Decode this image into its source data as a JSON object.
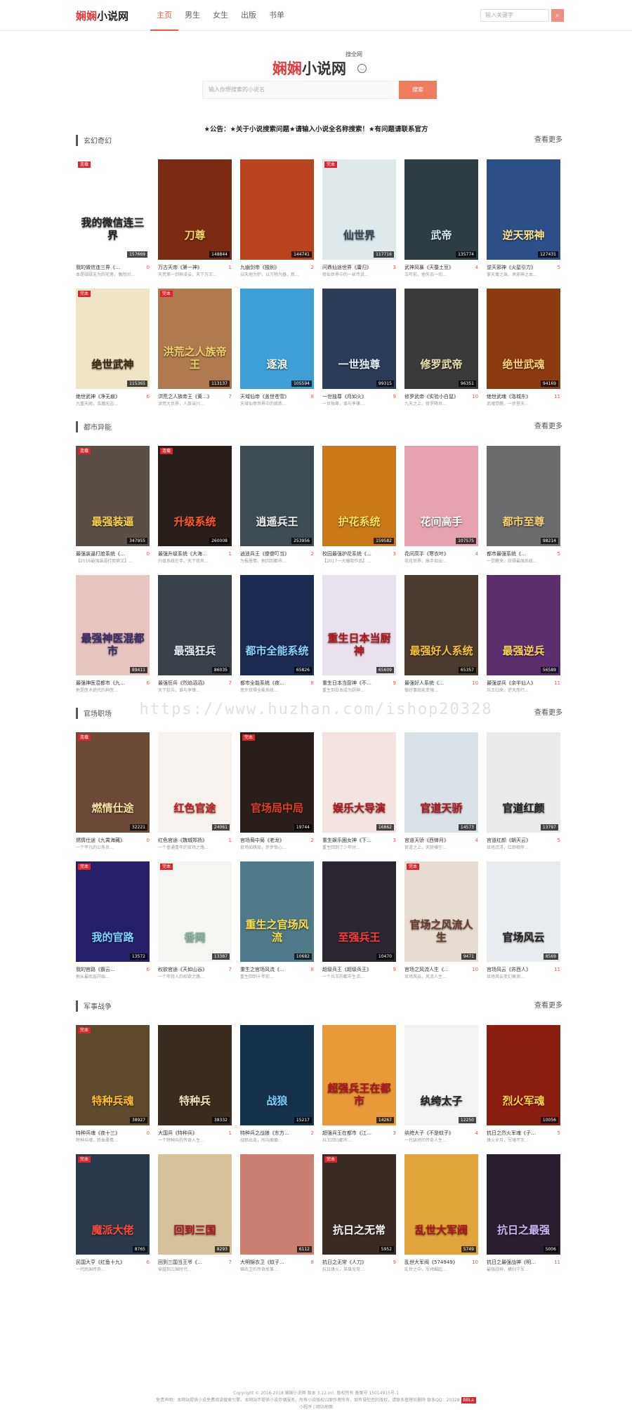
{
  "site": {
    "logo_hl": "娴娴",
    "logo_rest": "小说网",
    "nav": [
      "主页",
      "男生",
      "女生",
      "出版",
      "书单"
    ],
    "active_nav": 0,
    "top_search_placeholder": "输入关键字",
    "top_search_icon": "search-icon"
  },
  "hero": {
    "logo_hl": "娴娴",
    "logo_rest": "小说网",
    "tagline": "搜全网",
    "search_placeholder": "输入你想搜索的小说名",
    "search_button": "搜索"
  },
  "notice": "★公告：★关于小说搜索问题★请输入小说全名称搜索！★有问题请联系官方",
  "watermark": "https://www.huzhan.com/ishop20328",
  "colors": {
    "accent": "#ef5a3c",
    "tag": "#d9262c"
  },
  "sections": [
    {
      "title": "玄幻奇幻",
      "more": "查看更多",
      "books": [
        {
          "tag": "连载",
          "cnt": "157669",
          "name": "我的微信连三界《…",
          "num": "0",
          "desc": "本是碌碌无为的宅男，偶然间…",
          "ctitle": "我的微信连三界",
          "bg": "#ffffff",
          "fg": "#222222"
        },
        {
          "tag": "",
          "cnt": "148844",
          "name": "万古天帝《第一神》",
          "num": "1",
          "desc": "天荒第一剑神凌云，天下万王…",
          "ctitle": "刀尊",
          "bg": "#7a2b12",
          "fg": "#f7d56a"
        },
        {
          "tag": "",
          "cnt": "144741",
          "name": "九幽剑帝《独别》",
          "num": "2",
          "desc": "以天地为炉，以万物为器，炼…",
          "ctitle": "",
          "bg": "#b8431c",
          "fg": "#ffe08a"
        },
        {
          "tag": "完本",
          "cnt": "117716",
          "name": "问鼎仙途世界《庸归》",
          "num": "3",
          "desc": "修仙世界中的一丝传说…",
          "ctitle": "仙世界",
          "bg": "#dfe8ea",
          "fg": "#34495a"
        },
        {
          "tag": "",
          "cnt": "135774",
          "name": "武神风暴《天蚕土豆》",
          "num": "4",
          "desc": "五年前，他失去一切…",
          "ctitle": "武帝",
          "bg": "#2e3d44",
          "fg": "#d6e8f0"
        },
        {
          "tag": "",
          "cnt": "127431",
          "name": "逆天邪神《火星引力》",
          "num": "5",
          "desc": "掌天毒之珠，承邪神之血…",
          "ctitle": "逆天邪神",
          "bg": "#2b4f86",
          "fg": "#ffe28a"
        },
        {
          "tag": "完本",
          "cnt": "115365",
          "name": "绝世武神《净无痕》",
          "num": "6",
          "desc": "九重天阙，浩瀚无边…",
          "ctitle": "绝世武神",
          "bg": "#efe4c6",
          "fg": "#3b2a14"
        },
        {
          "tag": "完本",
          "cnt": "113137",
          "name": "洪荒之人族帝王《黄…》",
          "num": "7",
          "desc": "洪荒大世界，人族当兴…",
          "ctitle": "洪荒之人族帝王",
          "bg": "#b07a4e",
          "fg": "#f2d36b"
        },
        {
          "tag": "",
          "cnt": "105594",
          "name": "天域仙帝《盖世苍雪》",
          "num": "8",
          "desc": "天域仙帝世界中的修炼…",
          "ctitle": "逐浪",
          "bg": "#3d9fd6",
          "fg": "#ffffff"
        },
        {
          "tag": "",
          "cnt": "99315",
          "name": "一世独尊《月如火》",
          "num": "9",
          "desc": "一世独尊，谁与争锋…",
          "ctitle": "一世独尊",
          "bg": "#2c3b56",
          "fg": "#e8eef6"
        },
        {
          "tag": "",
          "cnt": "96351",
          "name": "修罗武帝《实验小白鼠》",
          "num": "10",
          "desc": "九天之上，修罗降世…",
          "ctitle": "修罗武帝",
          "bg": "#3a3a3a",
          "fg": "#f0e2b0"
        },
        {
          "tag": "",
          "cnt": "94169",
          "name": "绝世武魂《洛城东》",
          "num": "11",
          "desc": "武魂觉醒，一步登天…",
          "ctitle": "绝世武魂",
          "bg": "#8c3b10",
          "fg": "#ffd37a"
        }
      ]
    },
    {
      "title": "都市异能",
      "more": "查看更多",
      "books": [
        {
          "tag": "连载",
          "cnt": "347955",
          "name": "最强装逼打脸系统《…",
          "num": "0",
          "desc": "【2016最强装逼打脸爽文】…",
          "ctitle": "最强装逼",
          "bg": "#5b4e46",
          "fg": "#ffcf4a"
        },
        {
          "tag": "连载",
          "cnt": "260008",
          "name": "最强升级系统《大海…",
          "num": "1",
          "desc": "升级系统在手，天下我有…",
          "ctitle": "升级系统",
          "bg": "#2a1e1a",
          "fg": "#ff5a2a"
        },
        {
          "tag": "",
          "cnt": "253956",
          "name": "逍遥兵王《傻傻叮当》",
          "num": "2",
          "desc": "为报恩情，他回到都市…",
          "ctitle": "逍遥兵王",
          "bg": "#3d4c52",
          "fg": "#f2f2f2"
        },
        {
          "tag": "",
          "cnt": "159582",
          "name": "校园最强护花系统《…",
          "num": "3",
          "desc": "【2017一大爆款作品】…",
          "ctitle": "护花系统",
          "bg": "#c9791a",
          "fg": "#ffe45a"
        },
        {
          "tag": "",
          "cnt": "107575",
          "name": "花间高手《寒衣叶》",
          "num": "4",
          "desc": "花花世界，高手如云…",
          "ctitle": "花间高手",
          "bg": "#e8a3b0",
          "fg": "#ffffff"
        },
        {
          "tag": "",
          "cnt": "98214",
          "name": "都市最强系统《…",
          "num": "5",
          "desc": "一觉醒来，获得最强系统…",
          "ctitle": "都市至尊",
          "bg": "#6a6b6c",
          "fg": "#f8d46e"
        },
        {
          "tag": "",
          "cnt": "89411",
          "name": "最强神医混都市《九…",
          "num": "6",
          "desc": "他是医术绝代的神医…",
          "ctitle": "最强神医混都市",
          "bg": "#e6c4c0",
          "fg": "#3a2a66"
        },
        {
          "tag": "",
          "cnt": "86035",
          "name": "最强狂兵《烈焰滔滔》",
          "num": "7",
          "desc": "天下狂兵，谁与争锋…",
          "ctitle": "最强狂兵",
          "bg": "#39414a",
          "fg": "#e8edf2"
        },
        {
          "tag": "",
          "cnt": "65826",
          "name": "都市全能系统《夜…",
          "num": "8",
          "desc": "意外获得全能系统…",
          "ctitle": "都市全能系统",
          "bg": "#1b2a52",
          "fg": "#8ad4ff"
        },
        {
          "tag": "",
          "cnt": "65609",
          "name": "重生日本当厨神《不…",
          "num": "9",
          "desc": "重生到日本成为厨神…",
          "ctitle": "重生日本当厨神",
          "bg": "#e9e1ee",
          "fg": "#b2141c"
        },
        {
          "tag": "",
          "cnt": "65357",
          "name": "最强好人系统《…",
          "num": "10",
          "desc": "做好事就能变强…",
          "ctitle": "最强好人系统",
          "bg": "#4a3b2e",
          "fg": "#f4c23a"
        },
        {
          "tag": "",
          "cnt": "56589",
          "name": "最强逆兵《余半仙人》",
          "num": "11",
          "desc": "兵王归来，逆天而行…",
          "ctitle": "最强逆兵",
          "bg": "#5c2e6e",
          "fg": "#ffd45a"
        }
      ]
    },
    {
      "title": "官场职场",
      "more": "查看更多",
      "books": [
        {
          "tag": "连载",
          "cnt": "32221",
          "name": "燃情仕途《九霄海藏》",
          "num": "0",
          "desc": "一个平凡的公务员…",
          "ctitle": "燃情仕途",
          "bg": "#6b4a38",
          "fg": "#f7e3a2"
        },
        {
          "tag": "",
          "cnt": "24061",
          "name": "红色官途《魏城郑扬》",
          "num": "1",
          "desc": "一个普通青年的官场之路…",
          "ctitle": "红色官途",
          "bg": "#f7f2ee",
          "fg": "#c81e1e"
        },
        {
          "tag": "完本",
          "cnt": "19744",
          "name": "官场局中局《老龙》",
          "num": "2",
          "desc": "官场如棋局，步步惊心…",
          "ctitle": "官场局中局",
          "bg": "#2a1e1a",
          "fg": "#e33b2f"
        },
        {
          "tag": "",
          "cnt": "16862",
          "name": "重生娱乐圈女神《下…",
          "num": "3",
          "desc": "重生回到了少年时…",
          "ctitle": "娱乐大导演",
          "bg": "#f3e4e1",
          "fg": "#b2141c"
        },
        {
          "tag": "",
          "cnt": "14573",
          "name": "官道天骄《西锋月》",
          "num": "4",
          "desc": "官道之上，天骄横空…",
          "ctitle": "官道天骄",
          "bg": "#d9e2e6",
          "fg": "#b2141c"
        },
        {
          "tag": "",
          "cnt": "13797",
          "name": "官道红颜《朝天云》",
          "num": "5",
          "desc": "官场沉浮，红颜相伴…",
          "ctitle": "官道红颜",
          "bg": "#eaeaea",
          "fg": "#222222"
        },
        {
          "tag": "完本",
          "cnt": "13572",
          "name": "我的官路《霸云…",
          "num": "6",
          "desc": "他从最底层开始…",
          "ctitle": "我的官路",
          "bg": "#26206a",
          "fg": "#7fd6ff"
        },
        {
          "tag": "完本",
          "cnt": "13387",
          "name": "权欲官途《天如山谷》",
          "num": "7",
          "desc": "一个年轻人的权欲之路…",
          "ctitle": "香网",
          "bg": "#f4f6f2",
          "fg": "#8ab8a2"
        },
        {
          "tag": "",
          "cnt": "10682",
          "name": "重生之官场风流《…",
          "num": "8",
          "desc": "重生回到十年前…",
          "ctitle": "重生之官场风流",
          "bg": "#4e7a8a",
          "fg": "#ffe04a"
        },
        {
          "tag": "",
          "cnt": "10470",
          "name": "超级兵王《超级兵王》",
          "num": "9",
          "desc": "一个兵王的都市生活…",
          "ctitle": "至强兵王",
          "bg": "#2b2630",
          "fg": "#ff3a3a"
        },
        {
          "tag": "完本",
          "cnt": "9471",
          "name": "官场之风流人生《…",
          "num": "10",
          "desc": "官场风云，风流人生…",
          "ctitle": "官场之风流人生",
          "bg": "#e7dcd2",
          "fg": "#6a3a2a"
        },
        {
          "tag": "",
          "cnt": "8569",
          "name": "官场风云《苏西人》",
          "num": "11",
          "desc": "官场风云变幻莫测…",
          "ctitle": "官场风云",
          "bg": "#e8ecef",
          "fg": "#222222"
        }
      ]
    },
    {
      "title": "军事战争",
      "more": "查看更多",
      "books": [
        {
          "tag": "完本",
          "cnt": "38927",
          "name": "特种兵魂《夜十三》",
          "num": "0",
          "desc": "特种兵魂，铁血柔情…",
          "ctitle": "特种兵魂",
          "bg": "#5d4a2e",
          "fg": "#ffc02a"
        },
        {
          "tag": "",
          "cnt": "38332",
          "name": "大国兵《特种兵》",
          "num": "1",
          "desc": "一个特种兵的传奇人生…",
          "ctitle": "特种兵",
          "bg": "#3b2c20",
          "fg": "#f2e2c0"
        },
        {
          "tag": "",
          "cnt": "15217",
          "name": "特种兵之战狼《东方…",
          "num": "2",
          "desc": "战狼出击，所向披靡…",
          "ctitle": "战狼",
          "bg": "#16324a",
          "fg": "#7ad2ff"
        },
        {
          "tag": "",
          "cnt": "14267",
          "name": "超强兵王在都市《江…",
          "num": "3",
          "desc": "兵王回归都市…",
          "ctitle": "超强兵王在都市",
          "bg": "#e89a3a",
          "fg": "#b2141c"
        },
        {
          "tag": "",
          "cnt": "12250",
          "name": "纨绔大子《不是蚊子》",
          "num": "4",
          "desc": "一代纨绔的传奇人生…",
          "ctitle": "纨绔太子",
          "bg": "#f3f3f3",
          "fg": "#222222"
        },
        {
          "tag": "",
          "cnt": "10056",
          "name": "抗日之烈火军魂《子…",
          "num": "5",
          "desc": "烽火岁月，军魂不灭…",
          "ctitle": "烈火军魂",
          "bg": "#8a1e10",
          "fg": "#ffd54a"
        },
        {
          "tag": "完本",
          "cnt": "8765",
          "name": "民国大亨《红鱼十九》",
          "num": "6",
          "desc": "一代民国传奇…",
          "ctitle": "魔派大佬",
          "bg": "#2a3a4a",
          "fg": "#ff4a3a"
        },
        {
          "tag": "",
          "cnt": "8293",
          "name": "回到三国当王爷《…",
          "num": "7",
          "desc": "穿越到三国时代…",
          "ctitle": "回到三国",
          "bg": "#d6c29a",
          "fg": "#b2141c"
        },
        {
          "tag": "",
          "cnt": "6112",
          "name": "大明锦衣卫《蚊子…",
          "num": "8",
          "desc": "锦衣卫的传奇故事…",
          "ctitle": "",
          "bg": "#c98070",
          "fg": "#ffffff"
        },
        {
          "tag": "完本",
          "cnt": "5952",
          "name": "抗日之无常《人刀》",
          "num": "9",
          "desc": "抗日烽火，英雄无常…",
          "ctitle": "抗日之无常",
          "bg": "#3a2b24",
          "fg": "#ffffff"
        },
        {
          "tag": "",
          "cnt": "5749",
          "name": "乱世大军阀《574949》",
          "num": "10",
          "desc": "乱世之中，军阀崛起…",
          "ctitle": "乱世大军阀",
          "bg": "#e0a43a",
          "fg": "#b2141c"
        },
        {
          "tag": "",
          "cnt": "5006",
          "name": "抗日之最强战神《明…",
          "num": "11",
          "desc": "最强战神，横扫千军…",
          "ctitle": "抗日之最强",
          "bg": "#2a1e2e",
          "fg": "#c9b6f2"
        }
      ]
    }
  ],
  "footer": {
    "line1": "Copyright © 2016-2018 娴娴小说网 版本 3.12 Inc. 版权所有 备案号 15014915号-1",
    "line2": "免责声明：本网站提供小说免费阅读搜索引擎，本网站不提供小说存储服务，所有小说版权归原作者所有，如有侵犯您的版权，请联系管理员删除 联系QQ：20328",
    "badge": "BBLa",
    "line3": "小程序 | 网站地图"
  }
}
